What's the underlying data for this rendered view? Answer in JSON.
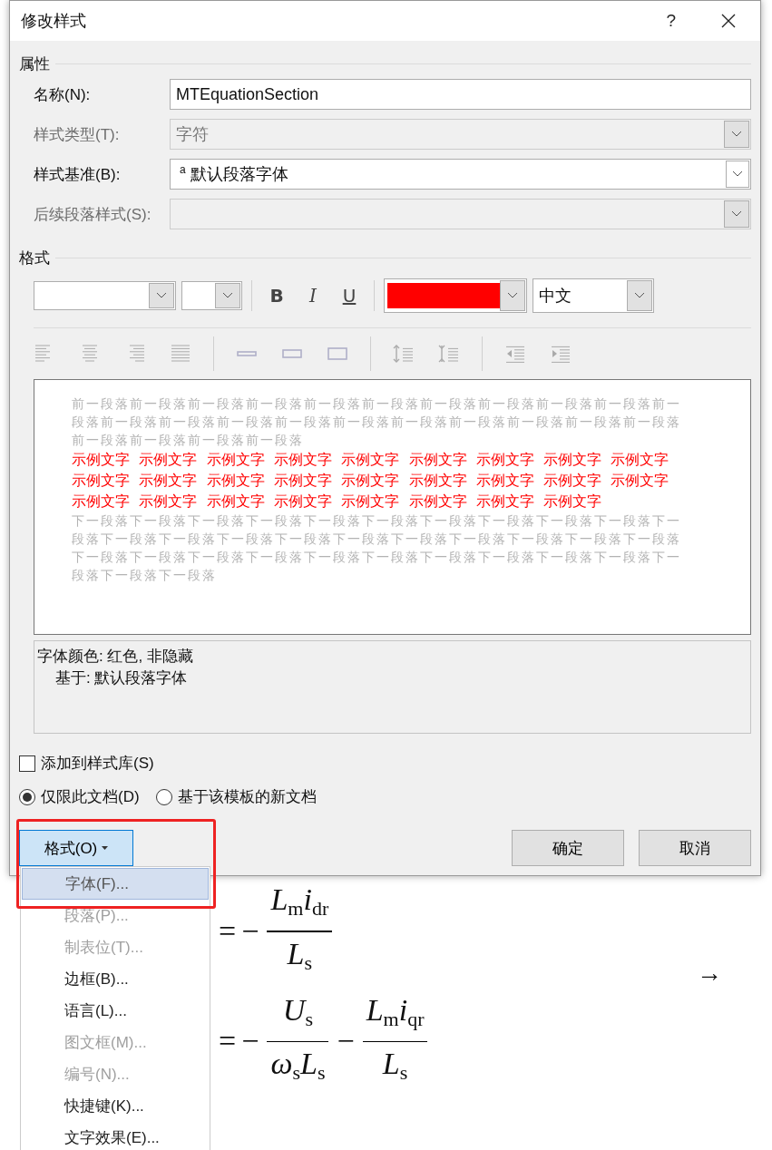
{
  "window": {
    "title": "修改样式",
    "help": "?"
  },
  "properties": {
    "heading": "属性",
    "fields": [
      {
        "label": "名称(N):",
        "kind": "text",
        "value": "MTEquationSection",
        "disabled": false
      },
      {
        "label": "样式类型(T):",
        "kind": "combo",
        "value": "字符",
        "disabled": true
      },
      {
        "label": "样式基准(B):",
        "kind": "combo",
        "prefix": "a",
        "value": "默认段落字体",
        "disabled": false
      },
      {
        "label": "后续段落样式(S):",
        "kind": "combo",
        "disabled": true
      }
    ]
  },
  "format": {
    "heading": "格式",
    "bold": "B",
    "italic": "I",
    "underline": "U",
    "color": "#ff0000",
    "language": "中文"
  },
  "preview": {
    "before": "前一段落前一段落前一段落前一段落前一段落前一段落前一段落前一段落前一段落前一段落前一段落前一段落前一段落前一段落前一段落前一段落前一段落前一段落前一段落前一段落前一段落前一段落前一段落前一段落前一段落",
    "sample_lines": [
      "示例文字 示例文字 示例文字 示例文字 示例文字 示例文字 示例文字 示例文字 示例文字",
      "示例文字 示例文字 示例文字 示例文字 示例文字 示例文字 示例文字 示例文字 示例文字",
      "示例文字 示例文字 示例文字 示例文字 示例文字 示例文字 示例文字 示例文字"
    ],
    "after": "下一段落下一段落下一段落下一段落下一段落下一段落下一段落下一段落下一段落下一段落下一段落下一段落下一段落下一段落下一段落下一段落下一段落下一段落下一段落下一段落下一段落下一段落下一段落下一段落下一段落下一段落下一段落下一段落下一段落下一段落下一段落下一段落下一段落下一段落"
  },
  "description": [
    "字体颜色: 红色, 非隐藏",
    "基于: 默认段落字体"
  ],
  "add_to_gallery": {
    "label": "添加到样式库(S)",
    "checked": false
  },
  "scope": [
    {
      "label": "仅限此文档(D)",
      "selected": true
    },
    {
      "label": "基于该模板的新文档",
      "selected": false
    }
  ],
  "buttons": {
    "format": "格式(O)",
    "ok": "确定",
    "cancel": "取消"
  },
  "menu": {
    "items": [
      {
        "label": "字体(F)...",
        "selected": true,
        "disabled": false
      },
      {
        "label": "段落(P)...",
        "selected": false,
        "disabled": true
      },
      {
        "label": "制表位(T)...",
        "selected": false,
        "disabled": true
      },
      {
        "label": "边框(B)...",
        "selected": false,
        "disabled": false
      },
      {
        "label": "语言(L)...",
        "selected": false,
        "disabled": false
      },
      {
        "label": "图文框(M)...",
        "selected": false,
        "disabled": true
      },
      {
        "label": "编号(N)...",
        "selected": false,
        "disabled": true
      },
      {
        "label": "快捷键(K)...",
        "selected": false,
        "disabled": false
      },
      {
        "label": "文字效果(E)...",
        "selected": false,
        "disabled": false
      }
    ]
  },
  "document": {
    "equations": [
      {
        "sign": "=",
        "terms": [
          {
            "sign": "−",
            "num": "L$_{m}$i$_{dr}$",
            "den": "L$_{s}$"
          }
        ]
      },
      {
        "sign": "=",
        "terms": [
          {
            "sign": "−",
            "num": "U$_{s}$",
            "den": "ω$_{s}$L$_{s}$"
          },
          {
            "sign": "−",
            "num": "L$_{m}$i$_{qr}$",
            "den": "L$_{s}$"
          }
        ]
      }
    ],
    "arrow": "→"
  }
}
